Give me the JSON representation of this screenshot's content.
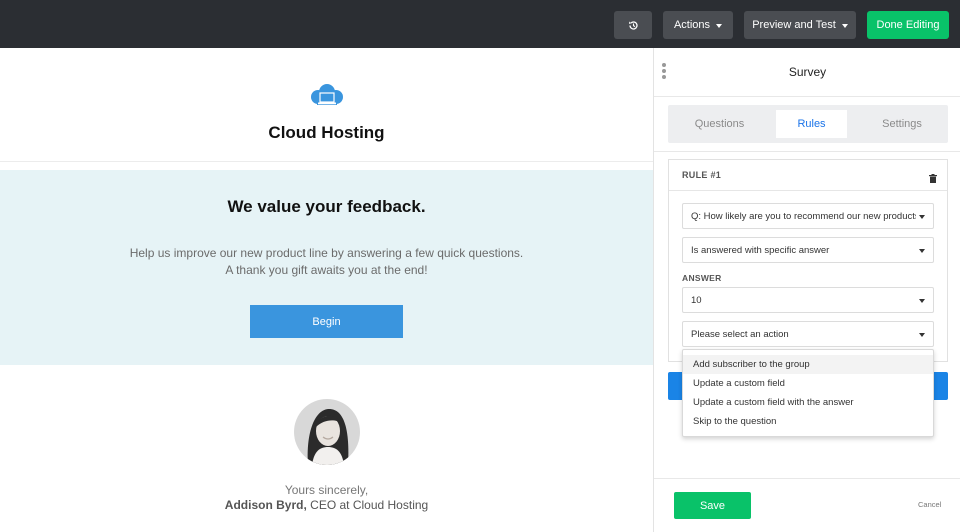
{
  "topbar": {
    "history_icon": "history-icon",
    "actions_label": "Actions",
    "preview_label": "Preview and Test",
    "done_label": "Done Editing",
    "done_color": "#09c269"
  },
  "preview": {
    "logo_icon": "cloud-laptop-icon",
    "brand_name": "Cloud Hosting",
    "hero_title": "We value your feedback.",
    "hero_line1": "Help us improve our new product line by answering a few quick questions.",
    "hero_line2": "A thank you gift awaits you at the end!",
    "begin_label": "Begin",
    "accent_color": "#3a95de",
    "sign_line1": "Yours sincerely,",
    "sign_name": "Addison Byrd,",
    "sign_role": " CEO at Cloud Hosting"
  },
  "panel": {
    "title": "Survey",
    "tabs": [
      {
        "label": "Questions",
        "active": false
      },
      {
        "label": "Rules",
        "active": true
      },
      {
        "label": "Settings",
        "active": false
      }
    ],
    "rule": {
      "title": "RULE #1",
      "question_value": "Q: How likely are you to recommend our new products",
      "condition_value": "Is answered with specific answer",
      "answer_label": "ANSWER",
      "answer_value": "10",
      "action_placeholder": "Please select an action"
    },
    "action_options": [
      "Add subscriber to the group",
      "Update a custom field",
      "Update a custom field with the answer",
      "Skip to the question"
    ],
    "save_label": "Save",
    "cancel_label": "Cancel"
  }
}
